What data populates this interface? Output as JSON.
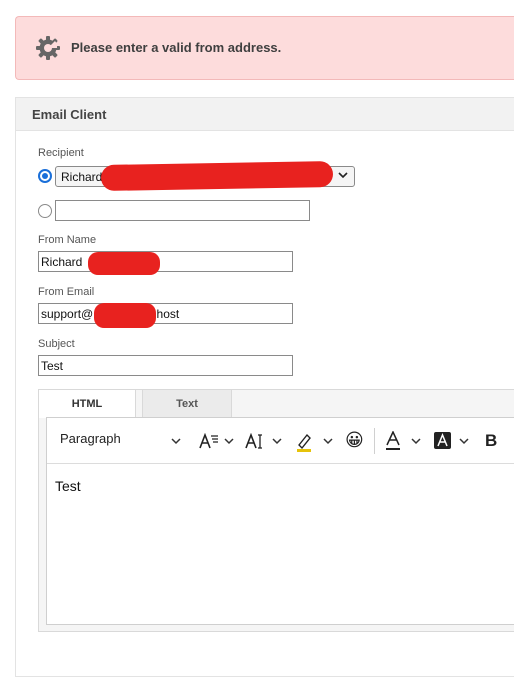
{
  "alert": {
    "icon": "gear-icon",
    "message": "Please enter a valid from address.",
    "color": "#fddcdc"
  },
  "panel": {
    "title": "Email Client"
  },
  "recipient": {
    "label": "Recipient",
    "selected_value": "Richard",
    "custom_value": ""
  },
  "from_name": {
    "label": "From Name",
    "value": "Richard"
  },
  "from_email": {
    "label": "From Email",
    "value_prefix": "support@",
    "value_suffix": ".host"
  },
  "subject": {
    "label": "Subject",
    "value": "Test"
  },
  "editor": {
    "tabs": [
      {
        "label": "HTML",
        "active": true
      },
      {
        "label": "Text",
        "active": false
      }
    ],
    "toolbar": {
      "block_format": "Paragraph",
      "emoji": "😀",
      "bold": "B"
    },
    "content": "Test"
  },
  "colors": {
    "accent": "#1a6fd9",
    "redaction": "#e8221f"
  }
}
